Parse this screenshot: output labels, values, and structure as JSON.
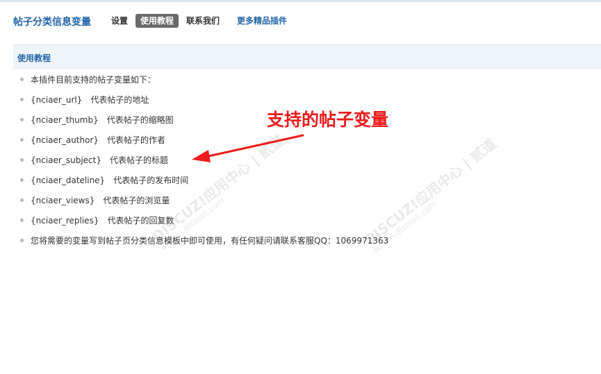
{
  "header": {
    "plugin_title": "帖子分类信息变量",
    "nav": {
      "settings": "设置",
      "tutorial": "使用教程",
      "contact": "联系我们",
      "more_plugins": "更多精品插件"
    }
  },
  "section": {
    "title": "使用教程"
  },
  "list": {
    "intro": "本插件目前支持的帖子变量如下：",
    "variables": [
      {
        "name": "{nciaer_url}",
        "desc": "代表帖子的地址"
      },
      {
        "name": "{nciaer_thumb}",
        "desc": "代表帖子的缩略图"
      },
      {
        "name": "{nciaer_author}",
        "desc": "代表帖子的作者"
      },
      {
        "name": "{nciaer_subject}",
        "desc": "代表帖子的标题"
      },
      {
        "name": "{nciaer_dateline}",
        "desc": "代表帖子的发布时间"
      },
      {
        "name": "{nciaer_views}",
        "desc": "代表帖子的浏览量"
      },
      {
        "name": "{nciaer_replies}",
        "desc": "代表帖子的回复数"
      }
    ],
    "footer": "您将需要的变量写到帖子页分类信息模板中即可使用，有任何疑问请联系客服QQ：1069971363"
  },
  "annotation": {
    "text": "支持的帖子变量",
    "color": "#ee1c1c"
  },
  "watermark": {
    "brand": "DISCUZ!应用中心 | 贰道",
    "url": "addon.dismall.com"
  },
  "colors": {
    "link_blue": "#2366a8",
    "active_tab_bg": "#6a6a6a",
    "section_bg": "#eef4f9"
  }
}
